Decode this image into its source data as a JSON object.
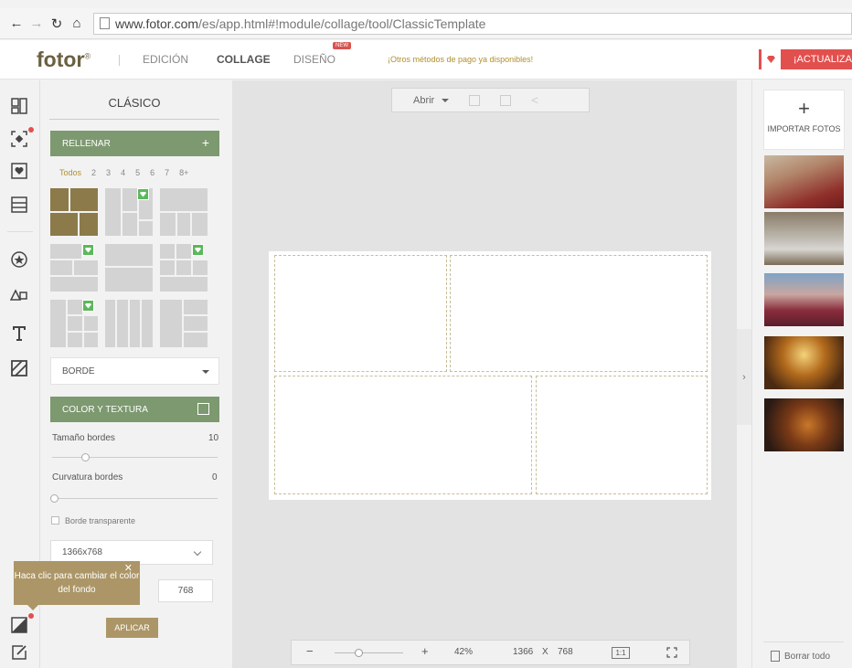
{
  "browser": {
    "url_host": "www.fotor.com",
    "url_path": "/es/app.html#!module/collage/tool/ClassicTemplate"
  },
  "header": {
    "logo": "fotor",
    "nav": [
      "EDICIÓN",
      "COLLAGE",
      "DISEÑO"
    ],
    "active_nav": "COLLAGE",
    "new_badge": "NEW",
    "promo": "¡Otros métodos de pago ya disponibles!",
    "upgrade": "¡ACTUALIZA"
  },
  "left_panel": {
    "title": "CLÁSICO",
    "fill_label": "RELLENAR",
    "fill_plus": "+",
    "filters": [
      "Todos",
      "2",
      "3",
      "4",
      "5",
      "6",
      "7",
      "8+"
    ],
    "border_select": "BORDE",
    "color_texture_label": "COLOR Y TEXTURA",
    "border_size_label": "Tamaño bordes",
    "border_size_value": "10",
    "corner_label": "Curvatura bordes",
    "corner_value": "0",
    "transparent_label": "Borde transparente",
    "size_select": "1366x768",
    "height_value": "768",
    "tooltip_text": "Haca clic para cambiar el color del fondo",
    "apply_label": "APLICAR"
  },
  "toolbar": {
    "open_label": "Abrir"
  },
  "zoom_bar": {
    "minus": "−",
    "plus": "+",
    "zoom": "42%",
    "width": "1366",
    "x": "X",
    "height": "768",
    "ratio": "1:1"
  },
  "right_panel": {
    "import_label": "IMPORTAR FOTOS",
    "clear_label": "Borrar todo"
  },
  "colors": {
    "accent_green": "#7d9970",
    "accent_gold": "#ac9667",
    "upgrade_red": "#e2504e"
  }
}
